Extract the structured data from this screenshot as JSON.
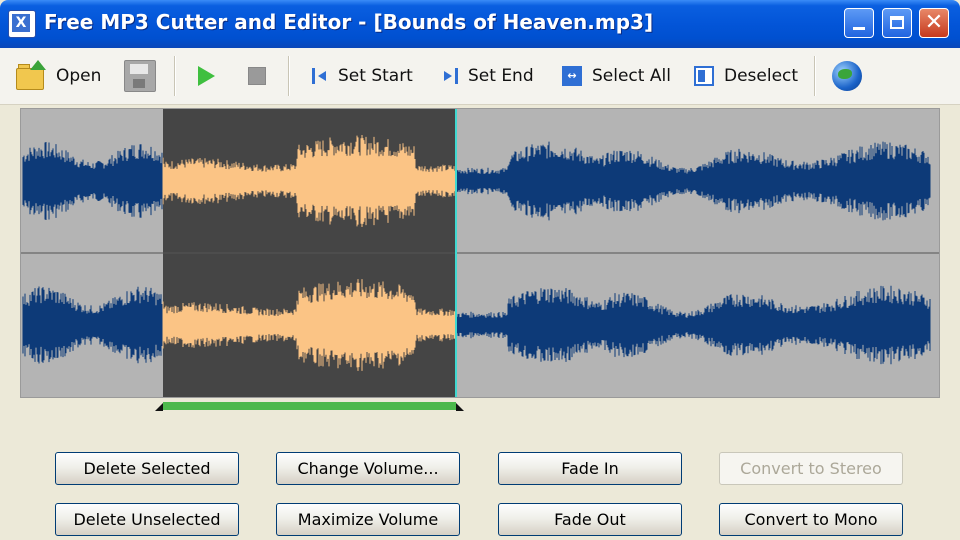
{
  "window": {
    "title": "Free MP3 Cutter and Editor - [Bounds of Heaven.mp3]",
    "app_icon_glyph": "X",
    "close_glyph": "✕"
  },
  "toolbar": {
    "open_label": "Open",
    "set_start_label": "Set Start",
    "set_end_label": "Set End",
    "select_all_label": "Select All",
    "deselect_label": "Deselect"
  },
  "colors": {
    "waveform": "#0d3a78",
    "selected_waveform": "#fbc485",
    "selection_background": "#454545",
    "panel_background": "#b4b4b4",
    "selection_bar": "#4cb84c",
    "cursor": "#40d8d0"
  },
  "selection": {
    "start_fraction": 0.155,
    "end_fraction": 0.474
  },
  "buttons": {
    "delete_selected": "Delete Selected",
    "change_volume": "Change Volume...",
    "fade_in": "Fade In",
    "convert_to_stereo": "Convert to Stereo",
    "delete_unselected": "Delete Unselected",
    "maximize_volume": "Maximize Volume",
    "fade_out": "Fade Out",
    "convert_to_mono": "Convert to Mono"
  }
}
